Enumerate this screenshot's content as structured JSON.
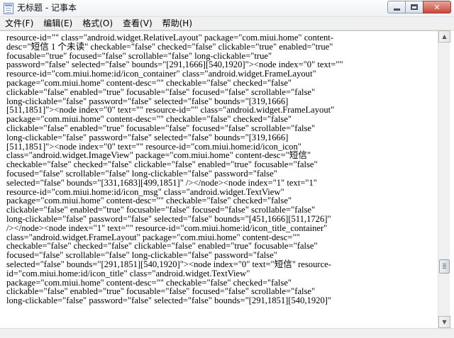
{
  "window": {
    "title": "无标题 - 记事本"
  },
  "menu": {
    "items": [
      "文件(F)",
      "编辑(E)",
      "格式(O)",
      "查看(V)",
      "帮助(H)"
    ]
  },
  "editor": {
    "lines": [
      "resource-id=\"\" class=\"android.widget.RelativeLayout\" package=\"com.miui.home\" content-",
      "desc=\"短信 1 个未读\" checkable=\"false\" checked=\"false\" clickable=\"true\" enabled=\"true\"",
      "focusable=\"true\" focused=\"false\" scrollable=\"false\" long-clickable=\"true\"",
      "password=\"false\" selected=\"false\" bounds=\"[291,1666][540,1920]\"><node index=\"0\" text=\"\"",
      "resource-id=\"com.miui.home:id/icon_container\" class=\"android.widget.FrameLayout\"",
      "package=\"com.miui.home\" content-desc=\"\" checkable=\"false\" checked=\"false\"",
      "clickable=\"false\" enabled=\"true\" focusable=\"false\" focused=\"false\" scrollable=\"false\"",
      "long-clickable=\"false\" password=\"false\" selected=\"false\" bounds=\"[319,1666]",
      "[511,1851]\"><node index=\"0\" text=\"\" resource-id=\"\" class=\"android.widget.FrameLayout\"",
      "package=\"com.miui.home\" content-desc=\"\" checkable=\"false\" checked=\"false\"",
      "clickable=\"false\" enabled=\"true\" focusable=\"false\" focused=\"false\" scrollable=\"false\"",
      "long-clickable=\"false\" password=\"false\" selected=\"false\" bounds=\"[319,1666]",
      "[511,1851]\"><node index=\"0\" text=\"\" resource-id=\"com.miui.home:id/icon_icon\"",
      "class=\"android.widget.ImageView\" package=\"com.miui.home\" content-desc=\"短信\"",
      "checkable=\"false\" checked=\"false\" clickable=\"false\" enabled=\"true\" focusable=\"false\"",
      "focused=\"false\" scrollable=\"false\" long-clickable=\"false\" password=\"false\"",
      "selected=\"false\" bounds=\"[331,1683][499,1851]\" /></node><node index=\"1\" text=\"1\"",
      "resource-id=\"com.miui.home:id/icon_msg\" class=\"android.widget.TextView\"",
      "package=\"com.miui.home\" content-desc=\"\" checkable=\"false\" checked=\"false\"",
      "clickable=\"false\" enabled=\"true\" focusable=\"false\" focused=\"false\" scrollable=\"false\"",
      "long-clickable=\"false\" password=\"false\" selected=\"false\" bounds=\"[451,1666][511,1726]\"",
      "/></node><node index=\"1\" text=\"\" resource-id=\"com.miui.home:id/icon_title_container\"",
      "class=\"android.widget.FrameLayout\" package=\"com.miui.home\" content-desc=\"\"",
      "checkable=\"false\" checked=\"false\" clickable=\"false\" enabled=\"true\" focusable=\"false\"",
      "focused=\"false\" scrollable=\"false\" long-clickable=\"false\" password=\"false\"",
      "selected=\"false\" bounds=\"[291,1851][540,1920]\"><node index=\"0\" text=\"短信\" resource-",
      "id=\"com.miui.home:id/icon_title\" class=\"android.widget.TextView\"",
      "package=\"com.miui.home\" content-desc=\"\" checkable=\"false\" checked=\"false\"",
      "clickable=\"false\" enabled=\"true\" focusable=\"false\" focused=\"false\" scrollable=\"false\"",
      "long-clickable=\"false\" password=\"false\" selected=\"false\" bounds=\"[291,1851][540,1920]\""
    ]
  },
  "icons": {
    "app": "notepad-icon",
    "minimize": "minimize-icon",
    "maximize": "maximize-icon",
    "close": "close-icon",
    "scroll_up": "scroll-up-arrow-icon",
    "scroll_down": "scroll-down-arrow-icon"
  },
  "colors": {
    "close_button": "#c9483a",
    "titlebar": "#eef1f5",
    "menubar": "#f0f0f0"
  }
}
